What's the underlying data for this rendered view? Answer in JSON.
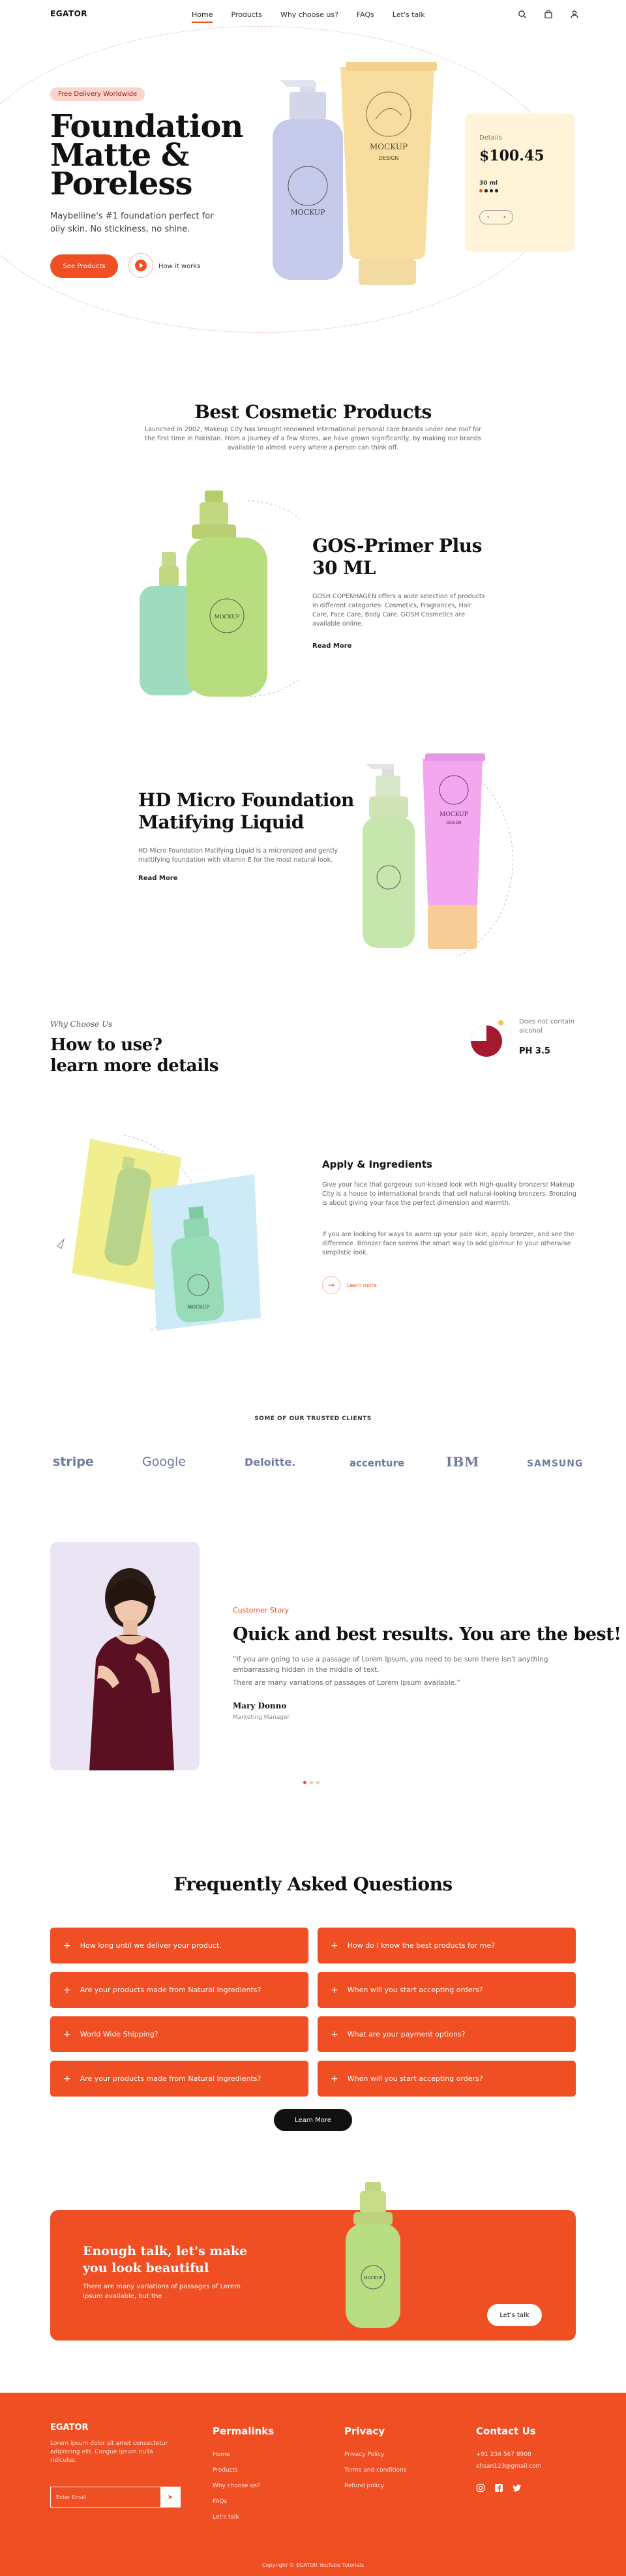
{
  "header": {
    "logo": "EGATOR",
    "nav": [
      "Home",
      "Products",
      "Why choose us?",
      "FAQs",
      "Let's talk"
    ],
    "icons": [
      "search-icon",
      "bag-icon",
      "user-icon"
    ]
  },
  "hero": {
    "badge": "Free Delivery Worldwide",
    "title_line1": "Foundation",
    "title_line2": "Matte &",
    "title_line3": "Poreless",
    "subtitle": "Maybelline's #1 foundation perfect for oily skin. No stickiness, no shine.",
    "cta": "See Products",
    "secondary": "How it works",
    "bottle_label": "MOCKUP",
    "tube_label": "MOCKUP",
    "tube_sublabel": "DESIGN",
    "card": {
      "details": "Details",
      "price": "$100.45",
      "size": "30 ml",
      "prev": "‹",
      "next": "›"
    }
  },
  "best": {
    "title": "Best Cosmetic Products",
    "intro": "Launched in 2002, Makeup City has brought renowned international personal care brands under one roof for the first time in Pakistan. From a journey of a few stores, we have grown significantly, by making our brands available to almost every where a person can think off."
  },
  "product1": {
    "title_line1": "GOS-Primer Plus",
    "title_line2": "30 ML",
    "desc": "GOSH COPENHAGEN offers a wide selection of products in different categories: Cosmetics, Fragrances, Hair Care, Face Care, Body Care. GOSH Cosmetics are available online.",
    "more": "Read More",
    "label": "MOCKUP"
  },
  "product2": {
    "title_line1": "HD Micro Foundation",
    "title_line2": "Matifying Liquid",
    "desc": "HD Micro Foundation Matifying Liquid is a micronized and gently mattifying foundation with vitamin E for the most natural look.",
    "more": "Read More",
    "label": "MOCKUP",
    "sublabel": "DESIGN"
  },
  "why": {
    "label": "Why Choose Us",
    "title_line1": "How to use?",
    "title_line2": "learn more details",
    "badge_text_line1": "Does not contain",
    "badge_text_line2": "alcohol",
    "ph": "PH 3.5"
  },
  "apply": {
    "title": "Apply & Ingredients",
    "p1": "Give your face that gorgeous sun-kissed look with High-quality bronzers! Makeup City is a house to international brands that sell natural-looking bronzers. Bronzing is about giving your face the perfect dimension and warmth.",
    "p2": "If you are looking for ways to warm up your pale skin, apply bronzer, and see the difference. Bronzer face seems the smart way to add glamour to your otherwise simplistic look.",
    "more": "Learn more",
    "label": "MOCKUP"
  },
  "clients": {
    "label": "SOME OF OUR TRUSTED CLIENTS",
    "names": [
      "stripe",
      "Google",
      "Deloitte.",
      "accenture",
      "IBM",
      "SAMSUNG"
    ]
  },
  "story": {
    "label": "Customer Story",
    "title": "Quick and best results. You are the best!",
    "quote1": "“If you are going to use a passage of Lorem Ipsum, you need to be sure there isn't anything embarrassing hidden in the middle of text.",
    "quote2": "There are many variations of passages of Lorem Ipsum available.”",
    "name": "Mary Donno",
    "role": "Marketing Manager"
  },
  "faq": {
    "title": "Frequently Asked Questions",
    "items": [
      "How long until we deliver your product.",
      "How do I know the best products for me?",
      "Are your products made from Natural Ingredients?",
      "When will you start accepting orders?",
      "World Wide Shipping?",
      "What are your payment options?",
      "Are your products made from Natural Ingredients?",
      "When will you start accepting orders?"
    ],
    "more": "Learn More"
  },
  "cta": {
    "title": "Enough talk, let's make you look beautiful",
    "sub": "There are many variations of passages of Lorem Ipsum available, but the",
    "button": "Let's talk",
    "label": "MOCKUP"
  },
  "footer": {
    "logo": "EGATOR",
    "desc": "Lorem ipsum dolor sit amet consectetur adipiscing elit. Congue ipsum nulla ridiculus.",
    "placeholder": "Enter Email",
    "col1_title": "Permalinks",
    "col1": [
      "Home",
      "Products",
      "Why choose us?",
      "FAQs",
      "Let's talk"
    ],
    "col2_title": "Privacy",
    "col2": [
      "Privacy Policy",
      "Terms and conditions",
      "Refund policy"
    ],
    "col3_title": "Contact Us",
    "col3": [
      "+91 234 567 8900",
      "ehsan123@gmail.com"
    ],
    "social": [
      "instagram-icon",
      "facebook-icon",
      "twitter-icon"
    ],
    "copyright": "Copyright © EGATOR YouTube Tutorials"
  },
  "colors": {
    "accent": "#f04e23",
    "cream": "#fff3d8",
    "lavender": "#ebe4f5"
  }
}
